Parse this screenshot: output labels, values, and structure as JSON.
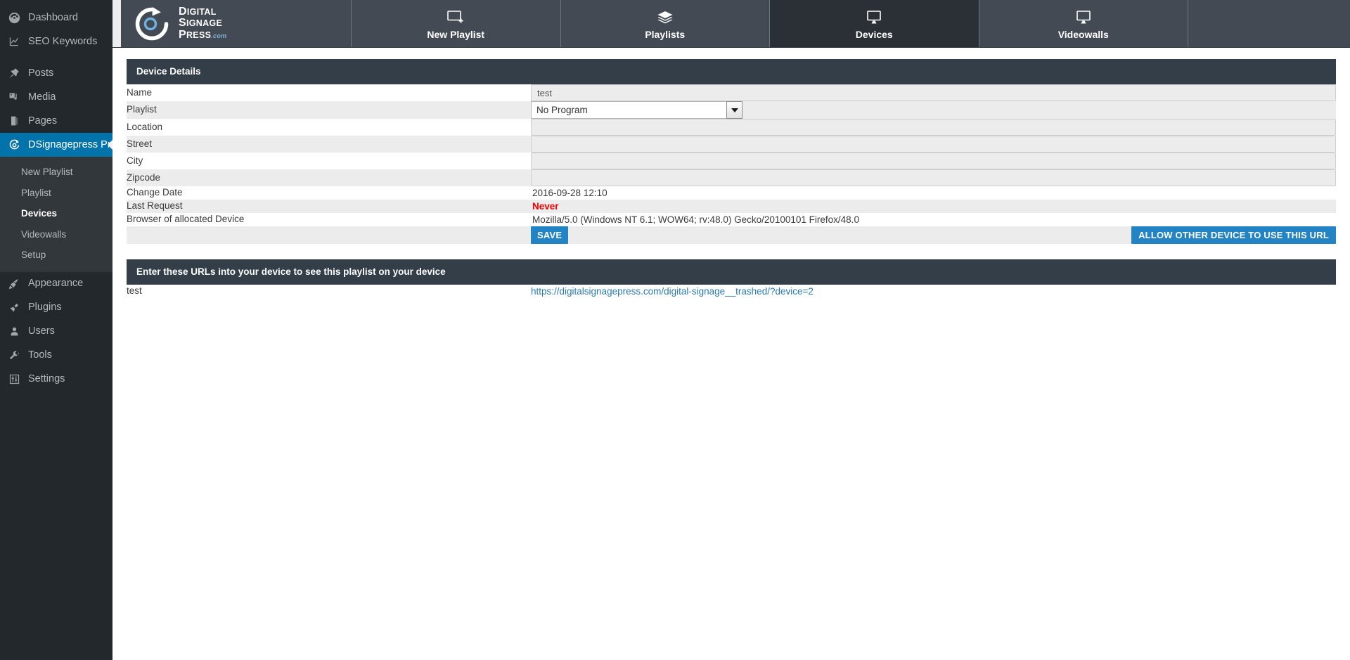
{
  "sidebar": {
    "items": [
      {
        "label": "Dashboard",
        "icon": "dashboard-icon"
      },
      {
        "label": "SEO Keywords",
        "icon": "chart-icon"
      },
      {
        "label": "Posts",
        "icon": "pin-icon"
      },
      {
        "label": "Media",
        "icon": "media-icon"
      },
      {
        "label": "Pages",
        "icon": "pages-icon"
      },
      {
        "label": "DSignagepress Pro",
        "icon": "dsignage-icon"
      },
      {
        "label": "Appearance",
        "icon": "brush-icon"
      },
      {
        "label": "Plugins",
        "icon": "plug-icon"
      },
      {
        "label": "Users",
        "icon": "user-icon"
      },
      {
        "label": "Tools",
        "icon": "wrench-icon"
      },
      {
        "label": "Settings",
        "icon": "sliders-icon"
      }
    ],
    "submenu": [
      {
        "label": "New Playlist"
      },
      {
        "label": "Playlist"
      },
      {
        "label": "Devices"
      },
      {
        "label": "Videowalls"
      },
      {
        "label": "Setup"
      }
    ],
    "active_item": "DSignagepress Pro",
    "active_subitem": "Devices",
    "accent_color": "#0073aa"
  },
  "topnav": {
    "logo": {
      "line1": "Digital",
      "line2": "Signage",
      "line3": "Press",
      "suffix": ".com",
      "icon": "circular-arrow-logo"
    },
    "tabs": [
      {
        "label": "New Playlist",
        "icon": "new-screen-icon",
        "active": false
      },
      {
        "label": "Playlists",
        "icon": "layers-icon",
        "active": false
      },
      {
        "label": "Devices",
        "icon": "monitor-icon",
        "active": true
      },
      {
        "label": "Videowalls",
        "icon": "monitor-icon",
        "active": false
      }
    ],
    "bar_color": "#434a54",
    "active_tab_color": "#2b3036"
  },
  "device_details": {
    "title": "Device Details",
    "fields": [
      {
        "label": "Name",
        "type": "text",
        "value": "test",
        "placeholder": ""
      },
      {
        "label": "Playlist",
        "type": "select",
        "value": "No Program"
      },
      {
        "label": "Location",
        "type": "text",
        "value": "",
        "placeholder": ""
      },
      {
        "label": "Street",
        "type": "text",
        "value": "",
        "placeholder": ""
      },
      {
        "label": "City",
        "type": "text",
        "value": "",
        "placeholder": ""
      },
      {
        "label": "Zipcode",
        "type": "text",
        "value": "",
        "placeholder": ""
      },
      {
        "label": "Change Date",
        "type": "static",
        "value": "2016-09-28 12:10"
      },
      {
        "label": "Last Request",
        "type": "alert",
        "value": "Never"
      },
      {
        "label": "Browser of allocated Device",
        "type": "static",
        "value": "Mozilla/5.0 (Windows NT 6.1; WOW64; rv:48.0) Gecko/20100101 Firefox/48.0"
      }
    ],
    "save_label": "SAVE",
    "allow_label": "ALLOW OTHER DEVICE TO USE THIS URL",
    "button_color": "#2284c5",
    "alert_color": "#ee0000"
  },
  "urls_panel": {
    "title": "Enter these URLs into your device to see this playlist on your device",
    "rows": [
      {
        "name": "test",
        "url": "https://digitalsignagepress.com/digital-signage__trashed/?device=2"
      }
    ]
  }
}
